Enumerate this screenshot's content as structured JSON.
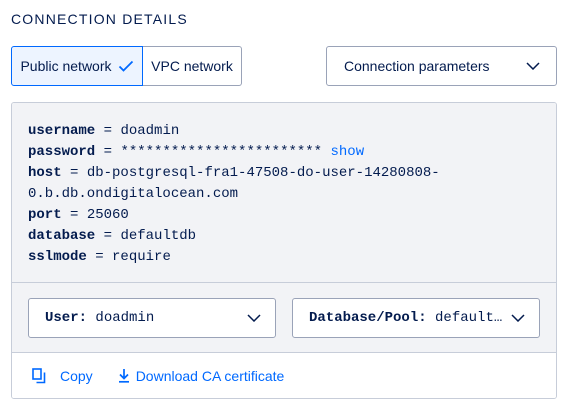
{
  "section": {
    "title": "CONNECTION DETAILS"
  },
  "network": {
    "public_label": "Public network",
    "vpc_label": "VPC network",
    "selected": "Public network"
  },
  "params_select": {
    "value": "Connection parameters"
  },
  "connection": {
    "username_key": "username",
    "username_val": "doadmin",
    "password_key": "password",
    "password_val": "************************",
    "password_show": "show",
    "host_key": "host",
    "host_val_1": "db-postgresql-fra1-47508-do-user-14280808-",
    "host_val_2": "0.b.db.ondigitalocean.com",
    "port_key": "port",
    "port_val": "25060",
    "database_key": "database",
    "database_val": "defaultdb",
    "sslmode_key": "sslmode",
    "sslmode_val": "require"
  },
  "user_select": {
    "label": "User:",
    "value": "doadmin"
  },
  "db_select": {
    "label": "Database/Pool:",
    "value": "default…"
  },
  "actions": {
    "copy_label": "Copy",
    "download_label": "Download CA certificate"
  },
  "colors": {
    "accent": "#0069ff",
    "text": "#031b4e",
    "panel_bg": "#f2f3f6",
    "border": "#c7cdd9"
  },
  "icons": [
    "check-icon",
    "chevron-down-icon",
    "copy-icon",
    "download-icon"
  ]
}
